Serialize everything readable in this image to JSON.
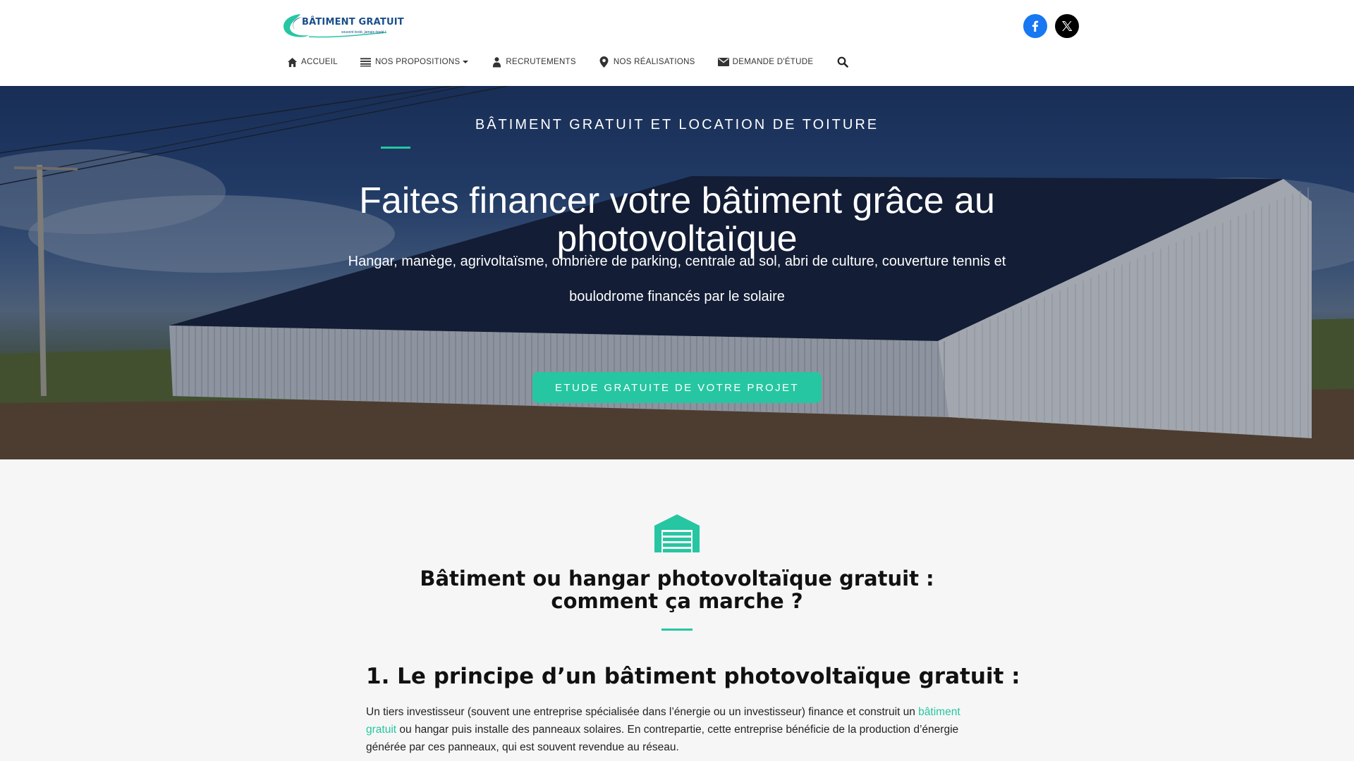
{
  "header": {
    "logo": {
      "title": "BÂTIMENT GRATUIT",
      "tagline": "souvent testé, jamais égalé !"
    },
    "social": [
      {
        "name": "facebook",
        "icon": "facebook-icon"
      },
      {
        "name": "x",
        "icon": "x-icon"
      }
    ],
    "nav": [
      {
        "label": "ACCUEIL",
        "icon": "home-icon"
      },
      {
        "label": "NOS PROPOSITIONS",
        "icon": "list-icon",
        "has_dropdown": true
      },
      {
        "label": "RECRUTEMENTS",
        "icon": "user-icon"
      },
      {
        "label": "NOS RÉALISATIONS",
        "icon": "map-pin-icon"
      },
      {
        "label": "DEMANDE D'ÉTUDE",
        "icon": "mail-icon"
      }
    ],
    "search_icon": "search-icon"
  },
  "hero": {
    "kicker": "BÂTIMENT GRATUIT ET LOCATION DE TOITURE",
    "title": "Faites financer votre bâtiment grâce au photovoltaïque",
    "subtitle": "Hangar, manège, agrivoltaïsme, ombrière de parking, centrale au sol, abri de culture, couverture tennis et boulodrome financés par le solaire",
    "cta": "ETUDE GRATUITE DE VOTRE PROJET"
  },
  "content": {
    "icon": "garage-icon",
    "section_title": "Bâtiment ou hangar photovoltaïque gratuit : comment ça marche ?",
    "heading": "1. Le principe d’un bâtiment photovoltaïque gratuit :",
    "para_before": "Un tiers investisseur (souvent une entreprise spécialisée dans l’énergie ou un investisseur) finance et construit un ",
    "para_link": "bâtiment gratuit",
    "para_after": " ou hangar puis installe des panneaux solaires. En contrepartie, cette entreprise bénéficie de la production d’énergie générée par ces panneaux, qui est souvent revendue au réseau."
  },
  "colors": {
    "accent": "#26c6a2",
    "facebook": "#1877f2",
    "x": "#000000",
    "logo_blue": "#1a4e8c"
  }
}
